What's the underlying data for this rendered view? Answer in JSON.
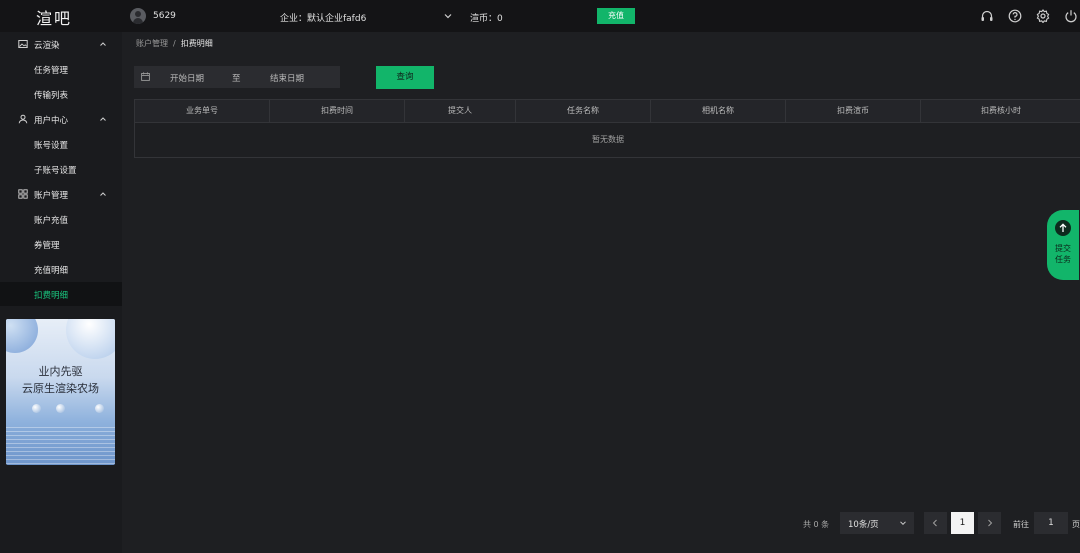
{
  "app": {
    "logo": "渲吧"
  },
  "topbar": {
    "user_id": "5629",
    "company": "企业：默认企业fafd6",
    "coin": "渲币：0",
    "recharge_label": "充值",
    "icons": [
      "headset-icon",
      "help-icon",
      "settings-icon",
      "power-icon"
    ]
  },
  "sidebar": {
    "groups": [
      {
        "label": "云渲染",
        "icon": "image-icon",
        "items": [
          "任务管理",
          "传输列表"
        ]
      },
      {
        "label": "用户中心",
        "icon": "user-icon",
        "items": [
          "账号设置",
          "子账号设置"
        ]
      },
      {
        "label": "账户管理",
        "icon": "grid-icon",
        "items": [
          "账户充值",
          "券管理",
          "充值明细",
          "扣费明细"
        ]
      }
    ],
    "active_item": "扣费明细",
    "banner": {
      "line1": "业内先驱",
      "line2": "云原生渲染农场"
    }
  },
  "breadcrumb": {
    "parent": "账户管理",
    "separator": "/",
    "current": "扣费明细"
  },
  "filters": {
    "start_placeholder": "开始日期",
    "range_sep": "至",
    "end_placeholder": "结束日期",
    "query_label": "查询"
  },
  "table": {
    "columns": [
      "业务单号",
      "扣费时间",
      "提交人",
      "任务名称",
      "相机名称",
      "扣费渲币",
      "扣费核小时"
    ],
    "empty_text": "暂无数据"
  },
  "float_submit": {
    "line1": "提交",
    "line2": "任务"
  },
  "pagination": {
    "total": "共 0 条",
    "page_size": "10条/页",
    "current_page": "1",
    "goto_label": "前往",
    "goto_value": "1",
    "goto_suffix": "页"
  },
  "colors": {
    "accent": "#12b56a",
    "background": "#1e1f22",
    "topbar": "#141416"
  }
}
